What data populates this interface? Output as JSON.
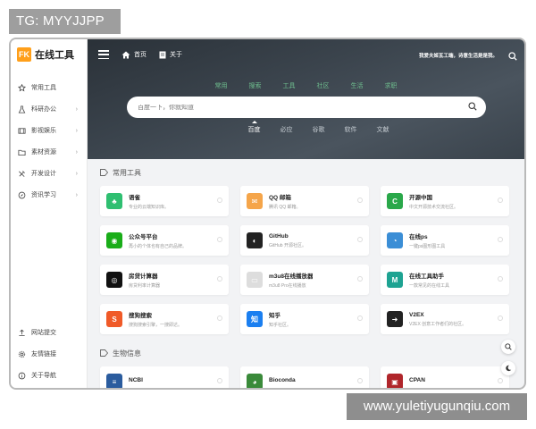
{
  "overlay": {
    "tg": "TG: MYYJJPP",
    "site": "www.yuletiyugunqiu.com"
  },
  "logo": {
    "badge": "FK",
    "text": "在线工具"
  },
  "sidebar": {
    "items": [
      {
        "label": "常用工具",
        "icon": "star-icon",
        "chevron": ""
      },
      {
        "label": "科研办公",
        "icon": "flask-icon",
        "chevron": "›"
      },
      {
        "label": "影视娱乐",
        "icon": "film-icon",
        "chevron": "›"
      },
      {
        "label": "素材资源",
        "icon": "folder-icon",
        "chevron": "›"
      },
      {
        "label": "开发设计",
        "icon": "tools-icon",
        "chevron": "›"
      },
      {
        "label": "资讯学习",
        "icon": "compass-icon",
        "chevron": "›"
      }
    ],
    "bottom": [
      {
        "label": "网站提交",
        "icon": "upload-icon"
      },
      {
        "label": "友情链接",
        "icon": "gear-icon"
      },
      {
        "label": "关于导航",
        "icon": "info-icon"
      }
    ]
  },
  "topbar": {
    "home": "首页",
    "about": "关于",
    "slogan": "我爱夫姬瓦工端，诗意生活是是我。"
  },
  "search": {
    "tabs": [
      "常用",
      "搜索",
      "工具",
      "社区",
      "生活",
      "求职"
    ],
    "placeholder": "百度一下，你就知道",
    "engines": [
      "百度",
      "必应",
      "谷歌",
      "软件",
      "文献"
    ],
    "active_engine": "百度"
  },
  "sections": [
    {
      "title": "常用工具",
      "cards": [
        {
          "title": "语雀",
          "desc": "专业的云端知识库。",
          "icon_text": "♣",
          "color": "#2fbf71"
        },
        {
          "title": "QQ 邮箱",
          "desc": "腾讯 QQ 邮箱。",
          "icon_text": "✉",
          "color": "#f5a54a"
        },
        {
          "title": "开源中国",
          "desc": "中文开源技术交流社区。",
          "icon_text": "C",
          "color": "#2aa84a"
        },
        {
          "title": "公众号平台",
          "desc": "再小的个体也有自己的品牌。",
          "icon_text": "◉",
          "color": "#1aad19"
        },
        {
          "title": "GitHub",
          "desc": "GitHub 开源社区。",
          "icon_text": "◐",
          "color": "#222222"
        },
        {
          "title": "在线ps",
          "desc": "一键ps图形图工具",
          "icon_text": "◔",
          "color": "#3b8ed6"
        },
        {
          "title": "房贷计算器",
          "desc": "房贷利率计算器",
          "icon_text": "◎",
          "color": "#111111"
        },
        {
          "title": "m3u8在线播放器",
          "desc": "m3u8 Pro在线播放",
          "icon_text": "▭",
          "color": "#dddddd"
        },
        {
          "title": "在线工具助手",
          "desc": "一款常见的在线工具",
          "icon_text": "M",
          "color": "#1ea392"
        },
        {
          "title": "搜狗搜索",
          "desc": "搜狗搜索引擎，一搜即达。",
          "icon_text": "S",
          "color": "#f05a28"
        },
        {
          "title": "知乎",
          "desc": "知乎社区。",
          "icon_text": "知",
          "color": "#1b7ff0"
        },
        {
          "title": "V2EX",
          "desc": "V2EX 创意工作者们的社区。",
          "icon_text": "➜",
          "color": "#222222"
        }
      ]
    },
    {
      "title": "生物信息",
      "cards": [
        {
          "title": "NCBI",
          "desc": "",
          "icon_text": "≡",
          "color": "#2b5c9e"
        },
        {
          "title": "Bioconda",
          "desc": "",
          "icon_text": "◕",
          "color": "#3a8a3a"
        },
        {
          "title": "CPAN",
          "desc": "",
          "icon_text": "▣",
          "color": "#b0262b"
        }
      ]
    }
  ]
}
